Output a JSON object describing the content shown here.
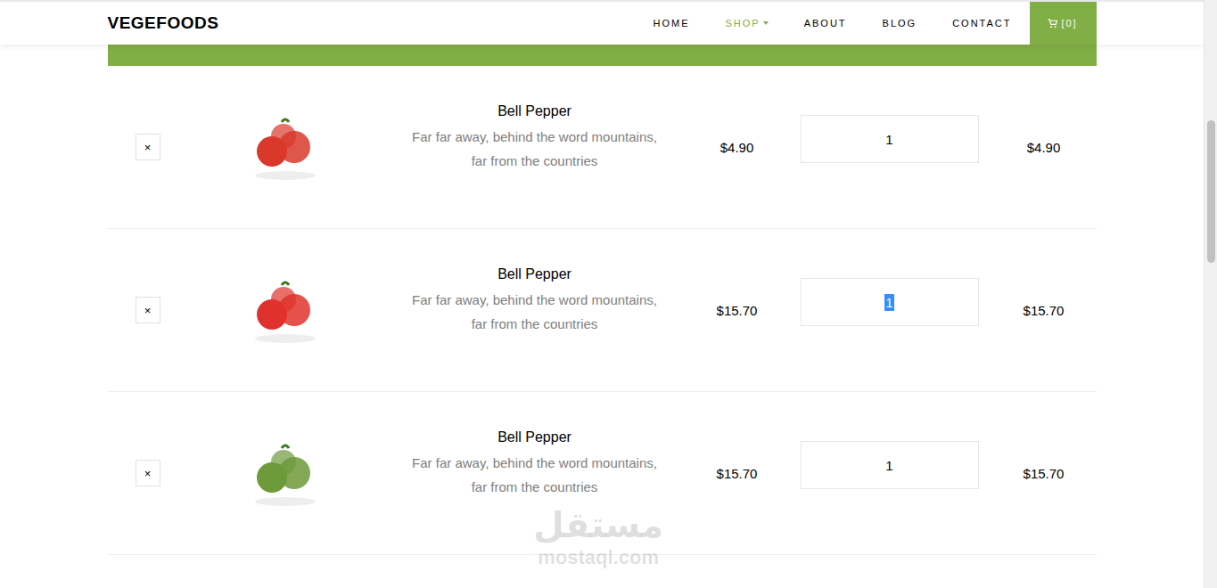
{
  "navbar": {
    "logo": "VEGEFOODS",
    "items": [
      {
        "label": "HOME",
        "selected": false,
        "dropdown": false
      },
      {
        "label": "SHOP",
        "selected": true,
        "dropdown": true
      },
      {
        "label": "ABOUT",
        "selected": false,
        "dropdown": false
      },
      {
        "label": "BLOG",
        "selected": false,
        "dropdown": false
      },
      {
        "label": "CONTACT",
        "selected": false,
        "dropdown": false
      }
    ],
    "cart": {
      "count": "[0]"
    }
  },
  "cart_rows": [
    {
      "remove": "×",
      "name": "Bell Pepper",
      "description": "Far far away, behind the word mountains, far from the countries",
      "price": "$4.90",
      "quantity": "1",
      "quantity_selected": false,
      "total": "$4.90",
      "color": "#d9382b"
    },
    {
      "remove": "×",
      "name": "Bell Pepper",
      "description": "Far far away, behind the word mountains, far from the countries",
      "price": "$15.70",
      "quantity": "1",
      "quantity_selected": true,
      "total": "$15.70",
      "color": "#e0322c"
    },
    {
      "remove": "×",
      "name": "Bell Pepper",
      "description": "Far far away, behind the word mountains, far from the countries",
      "price": "$15.70",
      "quantity": "1",
      "quantity_selected": false,
      "total": "$15.70",
      "color": "#6d9a3a"
    }
  ],
  "watermark": {
    "arabic": "مستقل",
    "latin": "mostaql.com"
  }
}
